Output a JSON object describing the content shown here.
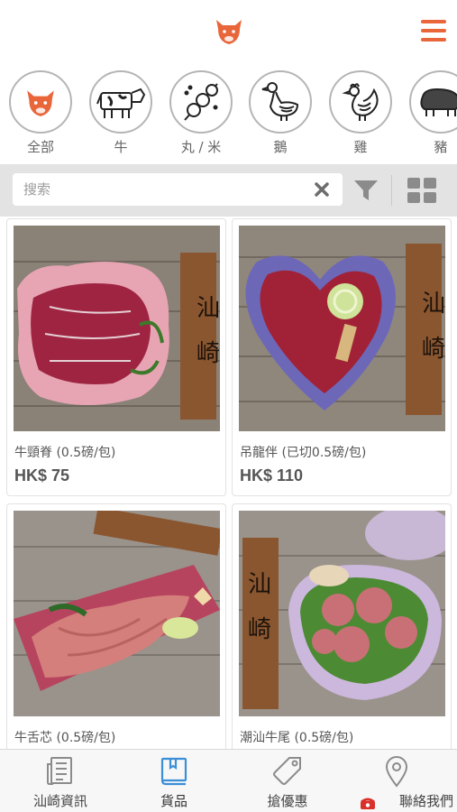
{
  "header": {
    "logo_icon": "ox-head-logo-icon",
    "menu_icon": "hamburger-menu-icon",
    "accent_color": "#e8663a"
  },
  "categories": [
    {
      "label": "全部",
      "icon": "ox-head-logo-icon"
    },
    {
      "label": "牛",
      "icon": "cow-icon"
    },
    {
      "label": "丸 / 米",
      "icon": "meatball-skewer-icon"
    },
    {
      "label": "鵝",
      "icon": "goose-icon"
    },
    {
      "label": "雞",
      "icon": "chicken-icon"
    },
    {
      "label": "豬",
      "icon": "pig-icon"
    }
  ],
  "search": {
    "placeholder": "搜索"
  },
  "products": [
    {
      "name": "牛頸脊 (0.5磅/包)",
      "price": "HK$ 75"
    },
    {
      "name": "吊龍伴 (已切0.5磅/包)",
      "price": "HK$ 110"
    },
    {
      "name": "牛舌芯 (0.5磅/包)",
      "price": ""
    },
    {
      "name": "潮汕牛尾 (0.5磅/包)",
      "price": ""
    }
  ],
  "nav": [
    {
      "label": "汕崎資訊",
      "icon": "newspaper-icon"
    },
    {
      "label": "貨品",
      "icon": "book-icon"
    },
    {
      "label": "搶優惠",
      "icon": "price-tag-icon"
    },
    {
      "label": "聯絡我們",
      "icon": "map-pin-icon"
    }
  ]
}
